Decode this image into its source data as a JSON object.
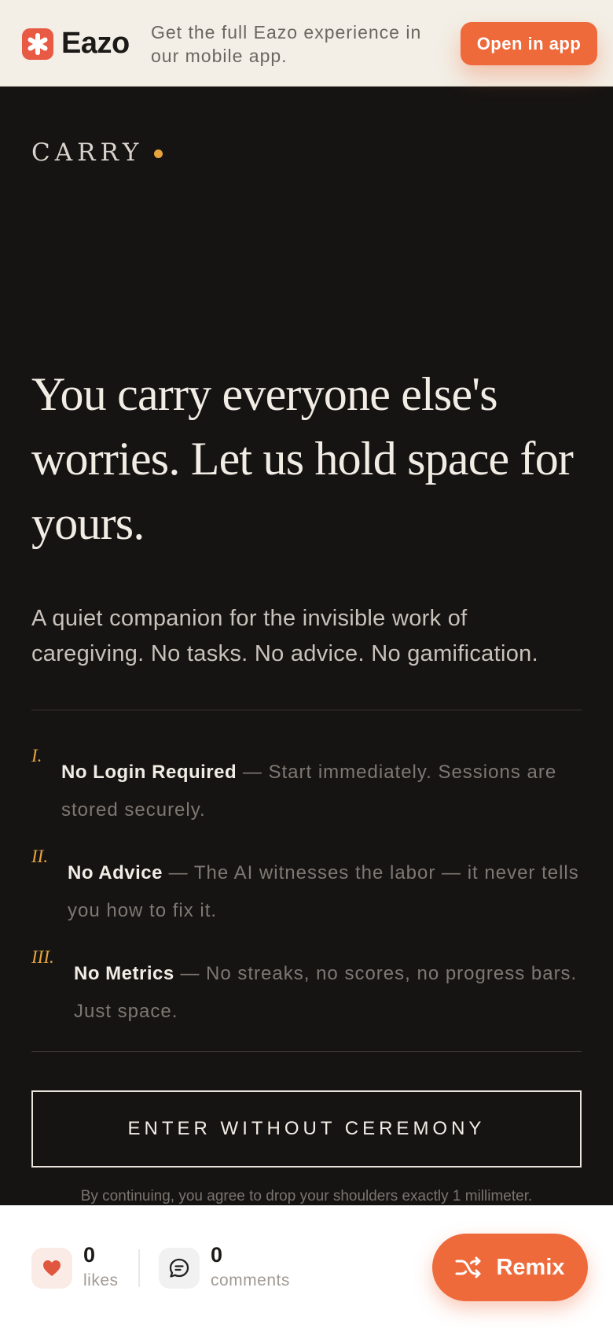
{
  "banner": {
    "brand": "Eazo",
    "message": "Get the full Eazo experience in our mobile app.",
    "open_button": "Open in app"
  },
  "page": {
    "eyebrow": "CARRY",
    "headline": "You carry everyone else's worries. Let us hold space for yours.",
    "subtext": "A quiet companion for the invisible work of caregiving. No tasks. No advice. No gamification.",
    "features": [
      {
        "numeral": "I.",
        "title": "No Login Required",
        "description": " — Start immediately. Sessions are stored securely."
      },
      {
        "numeral": "II.",
        "title": "No Advice",
        "description": " — The AI witnesses the labor — it never tells you how to fix it."
      },
      {
        "numeral": "III.",
        "title": "No Metrics",
        "description": " — No streaks, no scores, no progress bars. Just space."
      }
    ],
    "enter_button": "ENTER WITHOUT CEREMONY",
    "disclaimer": "By continuing, you agree to drop your shoulders exactly 1 millimeter."
  },
  "social": {
    "likes_count": "0",
    "likes_label": "likes",
    "comments_count": "0",
    "comments_label": "comments",
    "remix_button": "Remix"
  },
  "colors": {
    "accent": "#ee6a3b",
    "gold": "#e7a43d",
    "background": "#161413",
    "banner_bg": "#f3efe6"
  },
  "icons": [
    "eazo-logo-icon",
    "heart-icon",
    "comment-icon",
    "shuffle-icon"
  ]
}
